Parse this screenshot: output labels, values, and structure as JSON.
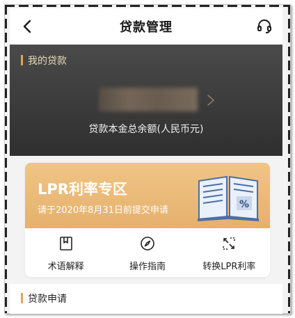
{
  "header": {
    "title": "贷款管理",
    "back_icon": "chevron-left-icon",
    "service_icon": "headset-icon"
  },
  "loan_card": {
    "section_title": "我的贷款",
    "amount_label": "贷款本金总余额(人民币元)",
    "amount_value_blurred": true
  },
  "lpr": {
    "title": "LPR利率专区",
    "subtitle": "请于2020年8月31日前提交申请",
    "illustration": "percent-book-illustration",
    "shortcuts": [
      {
        "label": "术语解释",
        "icon": "bookmark-book-icon"
      },
      {
        "label": "操作指南",
        "icon": "compass-icon"
      },
      {
        "label": "转换LPR利率",
        "icon": "convert-arrows-icon"
      }
    ]
  },
  "apply": {
    "section_title": "贷款申请"
  },
  "colors": {
    "accent_gold": "#d9a85a",
    "banner_gold": "#e6b06c",
    "card_dark": "#3a3a3a"
  }
}
